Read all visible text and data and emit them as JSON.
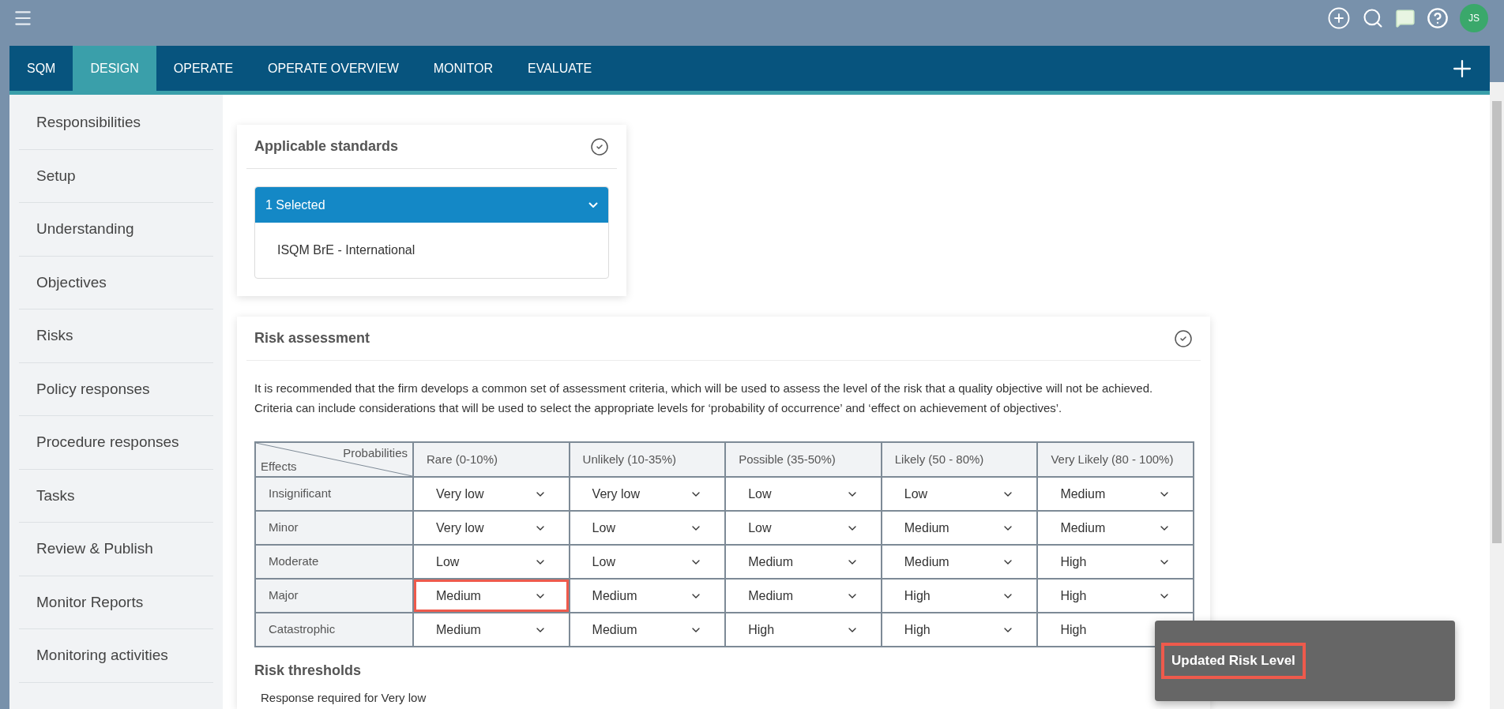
{
  "user": {
    "initials": "JS"
  },
  "nav": {
    "tabs": [
      {
        "label": "SQM",
        "selected": false
      },
      {
        "label": "DESIGN",
        "selected": true
      },
      {
        "label": "OPERATE",
        "selected": false
      },
      {
        "label": "OPERATE OVERVIEW",
        "selected": false
      },
      {
        "label": "MONITOR",
        "selected": false
      },
      {
        "label": "EVALUATE",
        "selected": false
      }
    ]
  },
  "sidebar": {
    "items": [
      {
        "label": "Responsibilities"
      },
      {
        "label": "Setup"
      },
      {
        "label": "Understanding"
      },
      {
        "label": "Objectives"
      },
      {
        "label": "Risks"
      },
      {
        "label": "Policy responses"
      },
      {
        "label": "Procedure responses"
      },
      {
        "label": "Tasks"
      },
      {
        "label": "Review & Publish"
      },
      {
        "label": "Monitor Reports"
      },
      {
        "label": "Monitoring activities"
      }
    ]
  },
  "applicable_standards": {
    "title": "Applicable standards",
    "dropdown": {
      "value": "1 Selected",
      "expanded": true,
      "options": [
        "ISQM BrE - International"
      ]
    }
  },
  "risk_assessment": {
    "title": "Risk assessment",
    "description": "It is recommended that the firm develops a common set of assessment criteria, which will be used to assess the level of the risk that a quality objective will not be achieved. Criteria can include considerations that will be used to select the appropriate levels for ‘probability of occurrence’ and ‘effect on achievement of objectives’.",
    "matrix": {
      "corner_top": "Probabilities",
      "corner_bottom": "Effects",
      "columns": [
        "Rare (0-10%)",
        "Unlikely (10-35%)",
        "Possible (35-50%)",
        "Likely (50 - 80%)",
        "Very Likely (80 - 100%)"
      ],
      "rows": [
        {
          "effect": "Insignificant",
          "cells": [
            {
              "value": "Very low",
              "highlighted": false
            },
            {
              "value": "Very low",
              "highlighted": false
            },
            {
              "value": "Low",
              "highlighted": false
            },
            {
              "value": "Low",
              "highlighted": false
            },
            {
              "value": "Medium",
              "highlighted": false
            }
          ]
        },
        {
          "effect": "Minor",
          "cells": [
            {
              "value": "Very low",
              "highlighted": false
            },
            {
              "value": "Low",
              "highlighted": false
            },
            {
              "value": "Low",
              "highlighted": false
            },
            {
              "value": "Medium",
              "highlighted": false
            },
            {
              "value": "Medium",
              "highlighted": false
            }
          ]
        },
        {
          "effect": "Moderate",
          "cells": [
            {
              "value": "Low",
              "highlighted": false
            },
            {
              "value": "Low",
              "highlighted": false
            },
            {
              "value": "Medium",
              "highlighted": false
            },
            {
              "value": "Medium",
              "highlighted": false
            },
            {
              "value": "High",
              "highlighted": false
            }
          ]
        },
        {
          "effect": "Major",
          "cells": [
            {
              "value": "Medium",
              "highlighted": true
            },
            {
              "value": "Medium",
              "highlighted": false
            },
            {
              "value": "Medium",
              "highlighted": false
            },
            {
              "value": "High",
              "highlighted": false
            },
            {
              "value": "High",
              "highlighted": false
            }
          ]
        },
        {
          "effect": "Catastrophic",
          "cells": [
            {
              "value": "Medium",
              "highlighted": false
            },
            {
              "value": "Medium",
              "highlighted": false
            },
            {
              "value": "High",
              "highlighted": false
            },
            {
              "value": "High",
              "highlighted": false
            },
            {
              "value": "High",
              "highlighted": false
            }
          ]
        }
      ]
    },
    "thresholds_title": "Risk thresholds",
    "thresholds_first": "Response required for Very low"
  },
  "toast": {
    "message": "Updated Risk Level",
    "highlighted": true
  }
}
